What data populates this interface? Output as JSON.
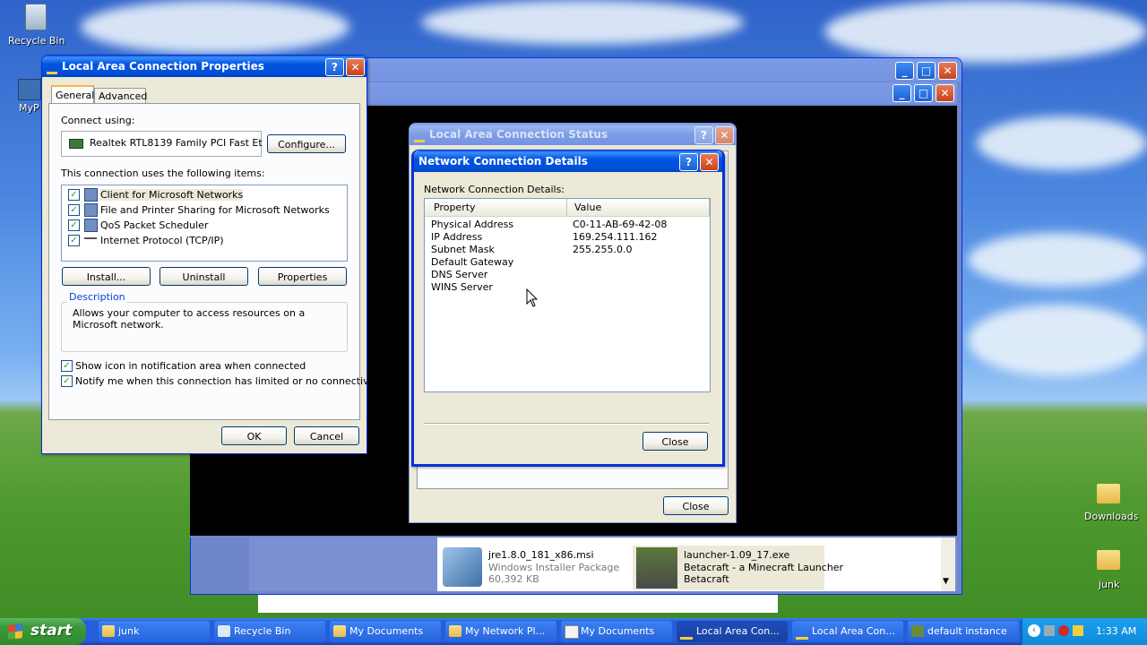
{
  "desktop": {
    "icons": [
      {
        "label": "Recycle Bin",
        "icon": "recycle-bin-icon"
      },
      {
        "label": "MyP",
        "icon": "my-pc-icon"
      },
      {
        "label": "Downloads",
        "icon": "folder-icon"
      },
      {
        "label": "junk",
        "icon": "folder-icon"
      }
    ]
  },
  "lac_properties": {
    "title": "Local Area Connection Properties",
    "tabs": [
      "General",
      "Advanced"
    ],
    "connect_using_label": "Connect using:",
    "adapter_name": "Realtek RTL8139 Family PCI Fast Et",
    "configure_label": "Configure...",
    "items_label": "This connection uses the following items:",
    "items": [
      {
        "label": "Client for Microsoft Networks",
        "checked": true
      },
      {
        "label": "File and Printer Sharing for Microsoft Networks",
        "checked": true
      },
      {
        "label": "QoS Packet Scheduler",
        "checked": true
      },
      {
        "label": "Internet Protocol (TCP/IP)",
        "checked": true
      }
    ],
    "install_label": "Install...",
    "uninstall_label": "Uninstall",
    "properties_label": "Properties",
    "description_title": "Description",
    "description_text": "Allows your computer to access resources on a Microsoft network.",
    "show_icon_label": "Show icon in notification area when connected",
    "notify_label": "Notify me when this connection has limited or no connectivity",
    "ok_label": "OK",
    "cancel_label": "Cancel"
  },
  "lac_status": {
    "title": "Local Area Connection Status",
    "close_label": "Close"
  },
  "ncd": {
    "title": "Network Connection Details",
    "label": "Network Connection Details:",
    "columns": [
      "Property",
      "Value"
    ],
    "rows": [
      {
        "property": "Physical Address",
        "value": "C0-11-AB-69-42-08"
      },
      {
        "property": "IP Address",
        "value": "169.254.111.162"
      },
      {
        "property": "Subnet Mask",
        "value": "255.255.0.0"
      },
      {
        "property": "Default Gateway",
        "value": ""
      },
      {
        "property": "DNS Server",
        "value": ""
      },
      {
        "property": "WINS Server",
        "value": ""
      }
    ],
    "close_label": "Close"
  },
  "files": [
    {
      "name": "jre1.8.0_181_x86.msi",
      "type": "Windows Installer Package",
      "size": "60,392 KB"
    },
    {
      "name": "launcher-1.09_17.exe",
      "type": "Betacraft - a Minecraft Launcher",
      "size": "Betacraft"
    }
  ],
  "taskbar": {
    "start_label": "start",
    "buttons": [
      {
        "label": "junk",
        "active": false
      },
      {
        "label": "Recycle Bin",
        "active": false
      },
      {
        "label": "My Documents",
        "active": false
      },
      {
        "label": "My Network Pl...",
        "active": false
      },
      {
        "label": "My Documents",
        "active": false
      },
      {
        "label": "Local Area Con...",
        "active": true
      },
      {
        "label": "Local Area Con...",
        "active": false
      },
      {
        "label": "default instance",
        "active": false
      }
    ],
    "clock": "1:33 AM"
  },
  "colors": {
    "xp_blue": "#0054e3",
    "desktop_green": "#4e9a2e",
    "taskbar": "#245edb",
    "start_green": "#3c9a3c"
  }
}
